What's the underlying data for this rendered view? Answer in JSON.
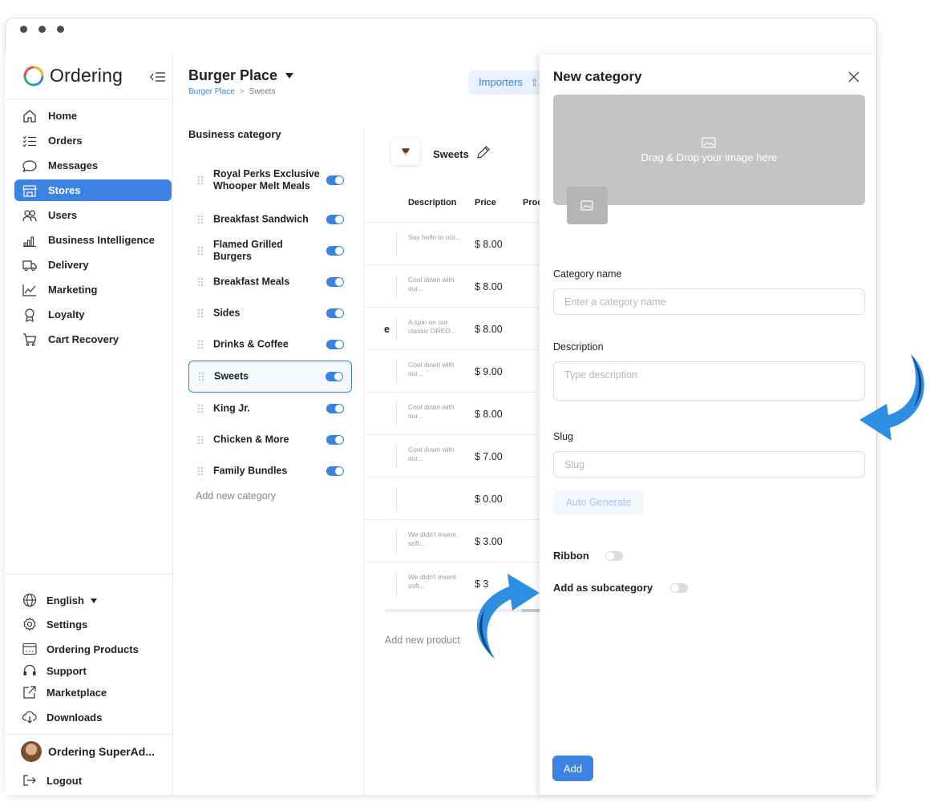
{
  "app": {
    "name": "Ordering"
  },
  "colors": {
    "accent": "#3b82e3",
    "accent_light": "#e8f1fd",
    "dropzone": "#c4c4c4",
    "arrow": "#2e8ee3",
    "arrow_dark": "#0d3d7a"
  },
  "sidebar": {
    "items": [
      {
        "label": "Home",
        "icon": "home-icon",
        "active": false
      },
      {
        "label": "Orders",
        "icon": "list-icon",
        "active": false
      },
      {
        "label": "Messages",
        "icon": "chat-icon",
        "active": false
      },
      {
        "label": "Stores",
        "icon": "store-icon",
        "active": true
      },
      {
        "label": "Users",
        "icon": "users-icon",
        "active": false
      },
      {
        "label": "Business Intelligence",
        "icon": "bar-chart-icon",
        "active": false
      },
      {
        "label": "Delivery",
        "icon": "truck-icon",
        "active": false
      },
      {
        "label": "Marketing",
        "icon": "line-chart-icon",
        "active": false
      },
      {
        "label": "Loyalty",
        "icon": "medal-icon",
        "active": false
      },
      {
        "label": "Cart Recovery",
        "icon": "cart-icon",
        "active": false
      }
    ],
    "bottom": {
      "language": "English",
      "settings": "Settings",
      "ordering_products": "Ordering Products",
      "support": "Support",
      "marketplace": "Marketplace",
      "downloads": "Downloads",
      "profile_name": "Ordering SuperAd...",
      "logout": "Logout"
    }
  },
  "main": {
    "store_title": "Burger Place",
    "breadcrumb": {
      "root": "Burger Place",
      "separator": ">",
      "current": "Sweets"
    },
    "importers_label": "Importers",
    "business_category_heading": "Business category",
    "categories": [
      {
        "name": "Royal Perks Exclusive Whooper Melt Meals",
        "enabled": true,
        "active": false
      },
      {
        "name": "Breakfast Sandwich",
        "enabled": true,
        "active": false
      },
      {
        "name": "Flamed Grilled Burgers",
        "enabled": true,
        "active": false
      },
      {
        "name": "Breakfast Meals",
        "enabled": true,
        "active": false
      },
      {
        "name": "Sides",
        "enabled": true,
        "active": false
      },
      {
        "name": "Drinks & Coffee",
        "enabled": true,
        "active": false
      },
      {
        "name": "Sweets",
        "enabled": true,
        "active": true
      },
      {
        "name": "King Jr.",
        "enabled": true,
        "active": false
      },
      {
        "name": "Chicken & More",
        "enabled": true,
        "active": false
      },
      {
        "name": "Family Bundles",
        "enabled": true,
        "active": false
      }
    ],
    "add_category": "Add new category",
    "selected_category": "Sweets",
    "table": {
      "headers": [
        "Description",
        "Price",
        "Proc"
      ],
      "rows": [
        {
          "cut": "",
          "description": "Say hello to our...",
          "price": "$ 8.00"
        },
        {
          "cut": "",
          "description": "Cool down with our...",
          "price": "$ 8.00"
        },
        {
          "cut": "e",
          "description": "A spin on our classic OREO...",
          "price": "$ 8.00"
        },
        {
          "cut": "",
          "description": "Cool down with our...",
          "price": "$ 9.00"
        },
        {
          "cut": "",
          "description": "Cool down with our...",
          "price": "$ 8.00"
        },
        {
          "cut": "",
          "description": "Cool down with our...",
          "price": "$ 7.00"
        },
        {
          "cut": "",
          "description": "",
          "price": "$ 0.00"
        },
        {
          "cut": "",
          "description": "We didn't invent soft...",
          "price": "$ 3.00"
        },
        {
          "cut": "",
          "description": "We didn't invent soft...",
          "price": "$ 3"
        }
      ]
    },
    "add_product": "Add new product"
  },
  "panel": {
    "title": "New category",
    "dropzone_text": "Drag & Drop your image here",
    "category_name_label": "Category name",
    "category_name_placeholder": "Enter a category name",
    "description_label": "Description",
    "description_placeholder": "Type description",
    "slug_label": "Slug",
    "slug_placeholder": "Slug",
    "auto_generate_label": "Auto Generate",
    "ribbon_label": "Ribbon",
    "ribbon_enabled": false,
    "subcategory_label": "Add as subcategory",
    "subcategory_enabled": false,
    "add_button": "Add"
  }
}
